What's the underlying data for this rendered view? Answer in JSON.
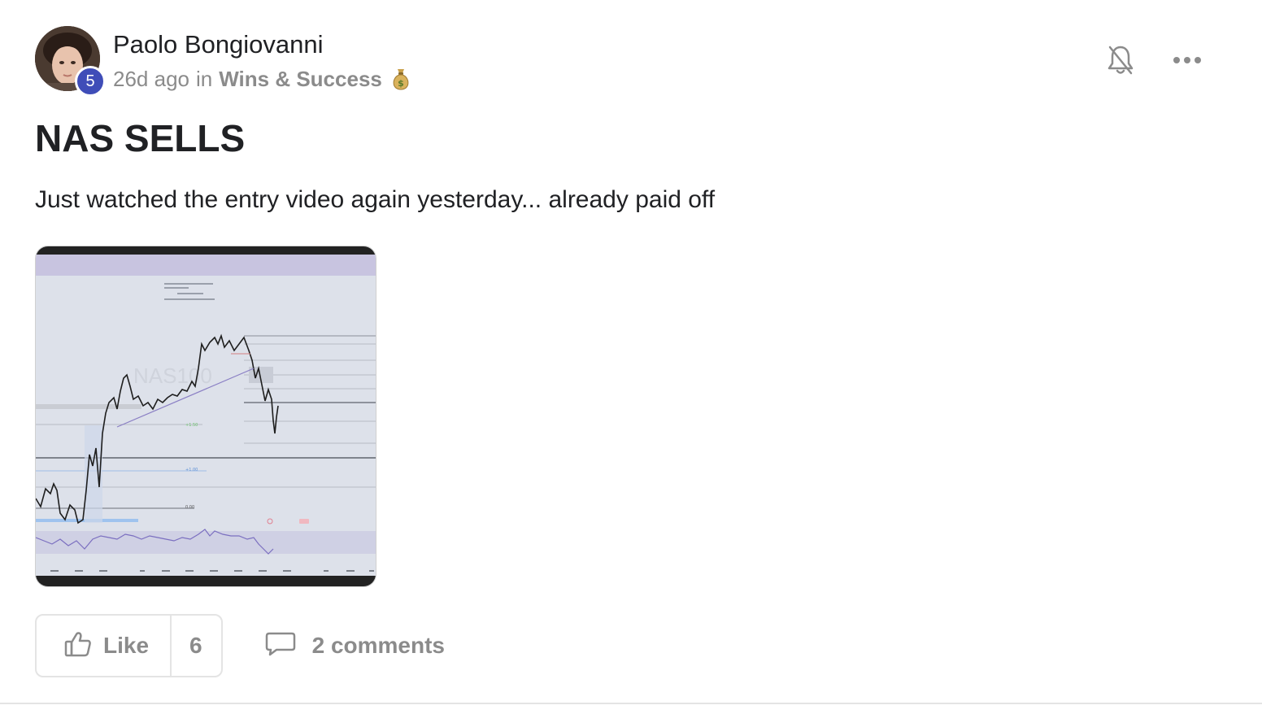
{
  "post": {
    "author": {
      "name": "Paolo Bongiovanni",
      "level": "5"
    },
    "time_ago": "26d ago",
    "in_label": "in",
    "category": "Wins & Success",
    "category_emoji_icon": "money-bag-icon",
    "title": "NAS SELLS",
    "body": "Just watched the entry video again yesterday... already paid off",
    "attachment": {
      "icon": "chart-screenshot-thumbnail",
      "watermark": "NAS100"
    },
    "actions": {
      "notification_icon": "bell-off-icon",
      "more_icon": "more-horizontal-icon"
    },
    "footer": {
      "like_label": "Like",
      "like_count": "6",
      "comments_label": "2 comments"
    }
  },
  "colors": {
    "badge": "#3f4db8",
    "muted_text": "#8b8b8b",
    "primary_text": "#202124",
    "border": "#e4e4e4"
  }
}
